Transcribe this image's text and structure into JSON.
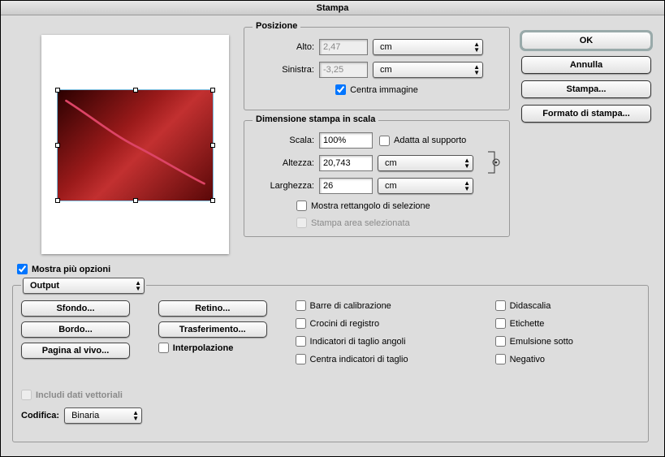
{
  "window": {
    "title": "Stampa"
  },
  "buttons": {
    "ok": "OK",
    "cancel": "Annulla",
    "print": "Stampa...",
    "page_setup": "Formato di stampa..."
  },
  "show_more": {
    "label": "Mostra più opzioni",
    "checked": true
  },
  "position": {
    "title": "Posizione",
    "top_label": "Alto:",
    "top_value": "2,47",
    "left_label": "Sinistra:",
    "left_value": "-3,25",
    "unit": "cm",
    "center_label": "Centra immagine",
    "center_checked": true,
    "inputs_disabled": true
  },
  "scaled_size": {
    "title": "Dimensione stampa in scala",
    "scale_label": "Scala:",
    "scale_value": "100%",
    "fit_label": "Adatta al supporto",
    "fit_checked": false,
    "height_label": "Altezza:",
    "height_value": "20,743",
    "width_label": "Larghezza:",
    "width_value": "26",
    "unit": "cm",
    "show_bbox_label": "Mostra rettangolo di selezione",
    "show_bbox_checked": false,
    "print_sel_label": "Stampa area selezionata",
    "print_sel_checked": false,
    "print_sel_disabled": true
  },
  "output": {
    "section_popup": "Output",
    "background_btn": "Sfondo...",
    "border_btn": "Bordo...",
    "bleed_btn": "Pagina al vivo...",
    "screen_btn": "Retino...",
    "transfer_btn": "Trasferimento...",
    "interpolation_label": "Interpolazione",
    "interpolation_checked": false,
    "cal_bars": "Barre di calibrazione",
    "reg_marks": "Crocini di registro",
    "corner_crop": "Indicatori di taglio angoli",
    "center_crop": "Centra indicatori di taglio",
    "caption": "Didascalia",
    "labels": "Etichette",
    "emulsion": "Emulsione sotto",
    "negative": "Negativo"
  },
  "vector": {
    "include_label": "Includi dati vettoriali",
    "include_checked": false,
    "include_disabled": true,
    "encoding_label": "Codifica:",
    "encoding_value": "Binaria"
  }
}
